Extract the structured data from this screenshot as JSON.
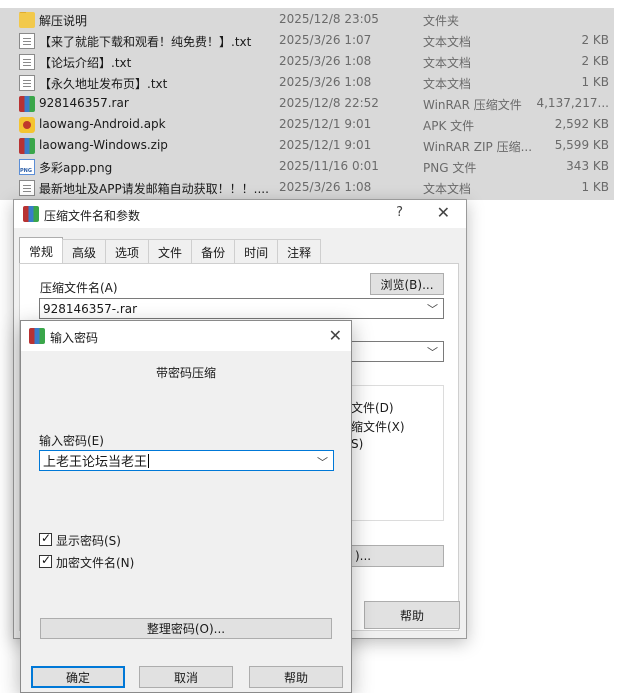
{
  "files": [
    {
      "name": "解压说明",
      "date": "2025/12/8 23:05",
      "type": "文件夹",
      "size": "",
      "icon": "folder-icon"
    },
    {
      "name": "【来了就能下载和观看！纯免费！】.txt",
      "date": "2025/3/26 1:07",
      "type": "文本文档",
      "size": "2 KB",
      "icon": "text-file-icon"
    },
    {
      "name": "【论坛介绍】.txt",
      "date": "2025/3/26 1:08",
      "type": "文本文档",
      "size": "2 KB",
      "icon": "text-file-icon"
    },
    {
      "name": "【永久地址发布页】.txt",
      "date": "2025/3/26 1:08",
      "type": "文本文档",
      "size": "1 KB",
      "icon": "text-file-icon"
    },
    {
      "name": "928146357.rar",
      "date": "2025/12/8 22:52",
      "type": "WinRAR 压缩文件",
      "size": "4,137,217...",
      "icon": "winrar-archive-icon"
    },
    {
      "name": "laowang-Android.apk",
      "date": "2025/12/1 9:01",
      "type": "APK 文件",
      "size": "2,592 KB",
      "icon": "apk-file-icon"
    },
    {
      "name": "laowang-Windows.zip",
      "date": "2025/12/1 9:01",
      "type": "WinRAR ZIP 压缩...",
      "size": "5,599 KB",
      "icon": "winrar-zip-icon"
    },
    {
      "name": "多彩app.png",
      "date": "2025/11/16 0:01",
      "type": "PNG 文件",
      "size": "343 KB",
      "icon": "png-file-icon"
    },
    {
      "name": "最新地址及APP请发邮箱自动获取！！！....",
      "date": "2025/3/26 1:08",
      "type": "文本文档",
      "size": "1 KB",
      "icon": "text-file-icon"
    }
  ],
  "archive_dialog": {
    "title": "压缩文件名和参数",
    "help_glyph": "?",
    "close_glyph": "✕",
    "tabs": [
      "常规",
      "高级",
      "选项",
      "文件",
      "备份",
      "时间",
      "注释"
    ],
    "archive_name_label": "压缩文件名(A)",
    "browse_button": "浏览(B)...",
    "archive_name_value": "928146357-.rar",
    "partial_option_1": "文件(D)",
    "partial_option_2": "缩文件(X)",
    "partial_option_3": "S)",
    "partial_button": ")...",
    "help_button": "帮助"
  },
  "password_dialog": {
    "title": "输入密码",
    "close_glyph": "✕",
    "heading": "带密码压缩",
    "password_label": "输入密码(E)",
    "password_value": "上老王论坛当老王",
    "show_password_label": "显示密码(S)",
    "show_password_checked": true,
    "encrypt_names_label": "加密文件名(N)",
    "encrypt_names_checked": true,
    "organize_button": "整理密码(O)...",
    "ok_button": "确定",
    "cancel_button": "取消",
    "help_button": "帮助"
  },
  "colors": {
    "selection_bg": "#d9d9d9",
    "focus_border": "#0078d7",
    "dialog_bg": "#f0f0f0"
  }
}
